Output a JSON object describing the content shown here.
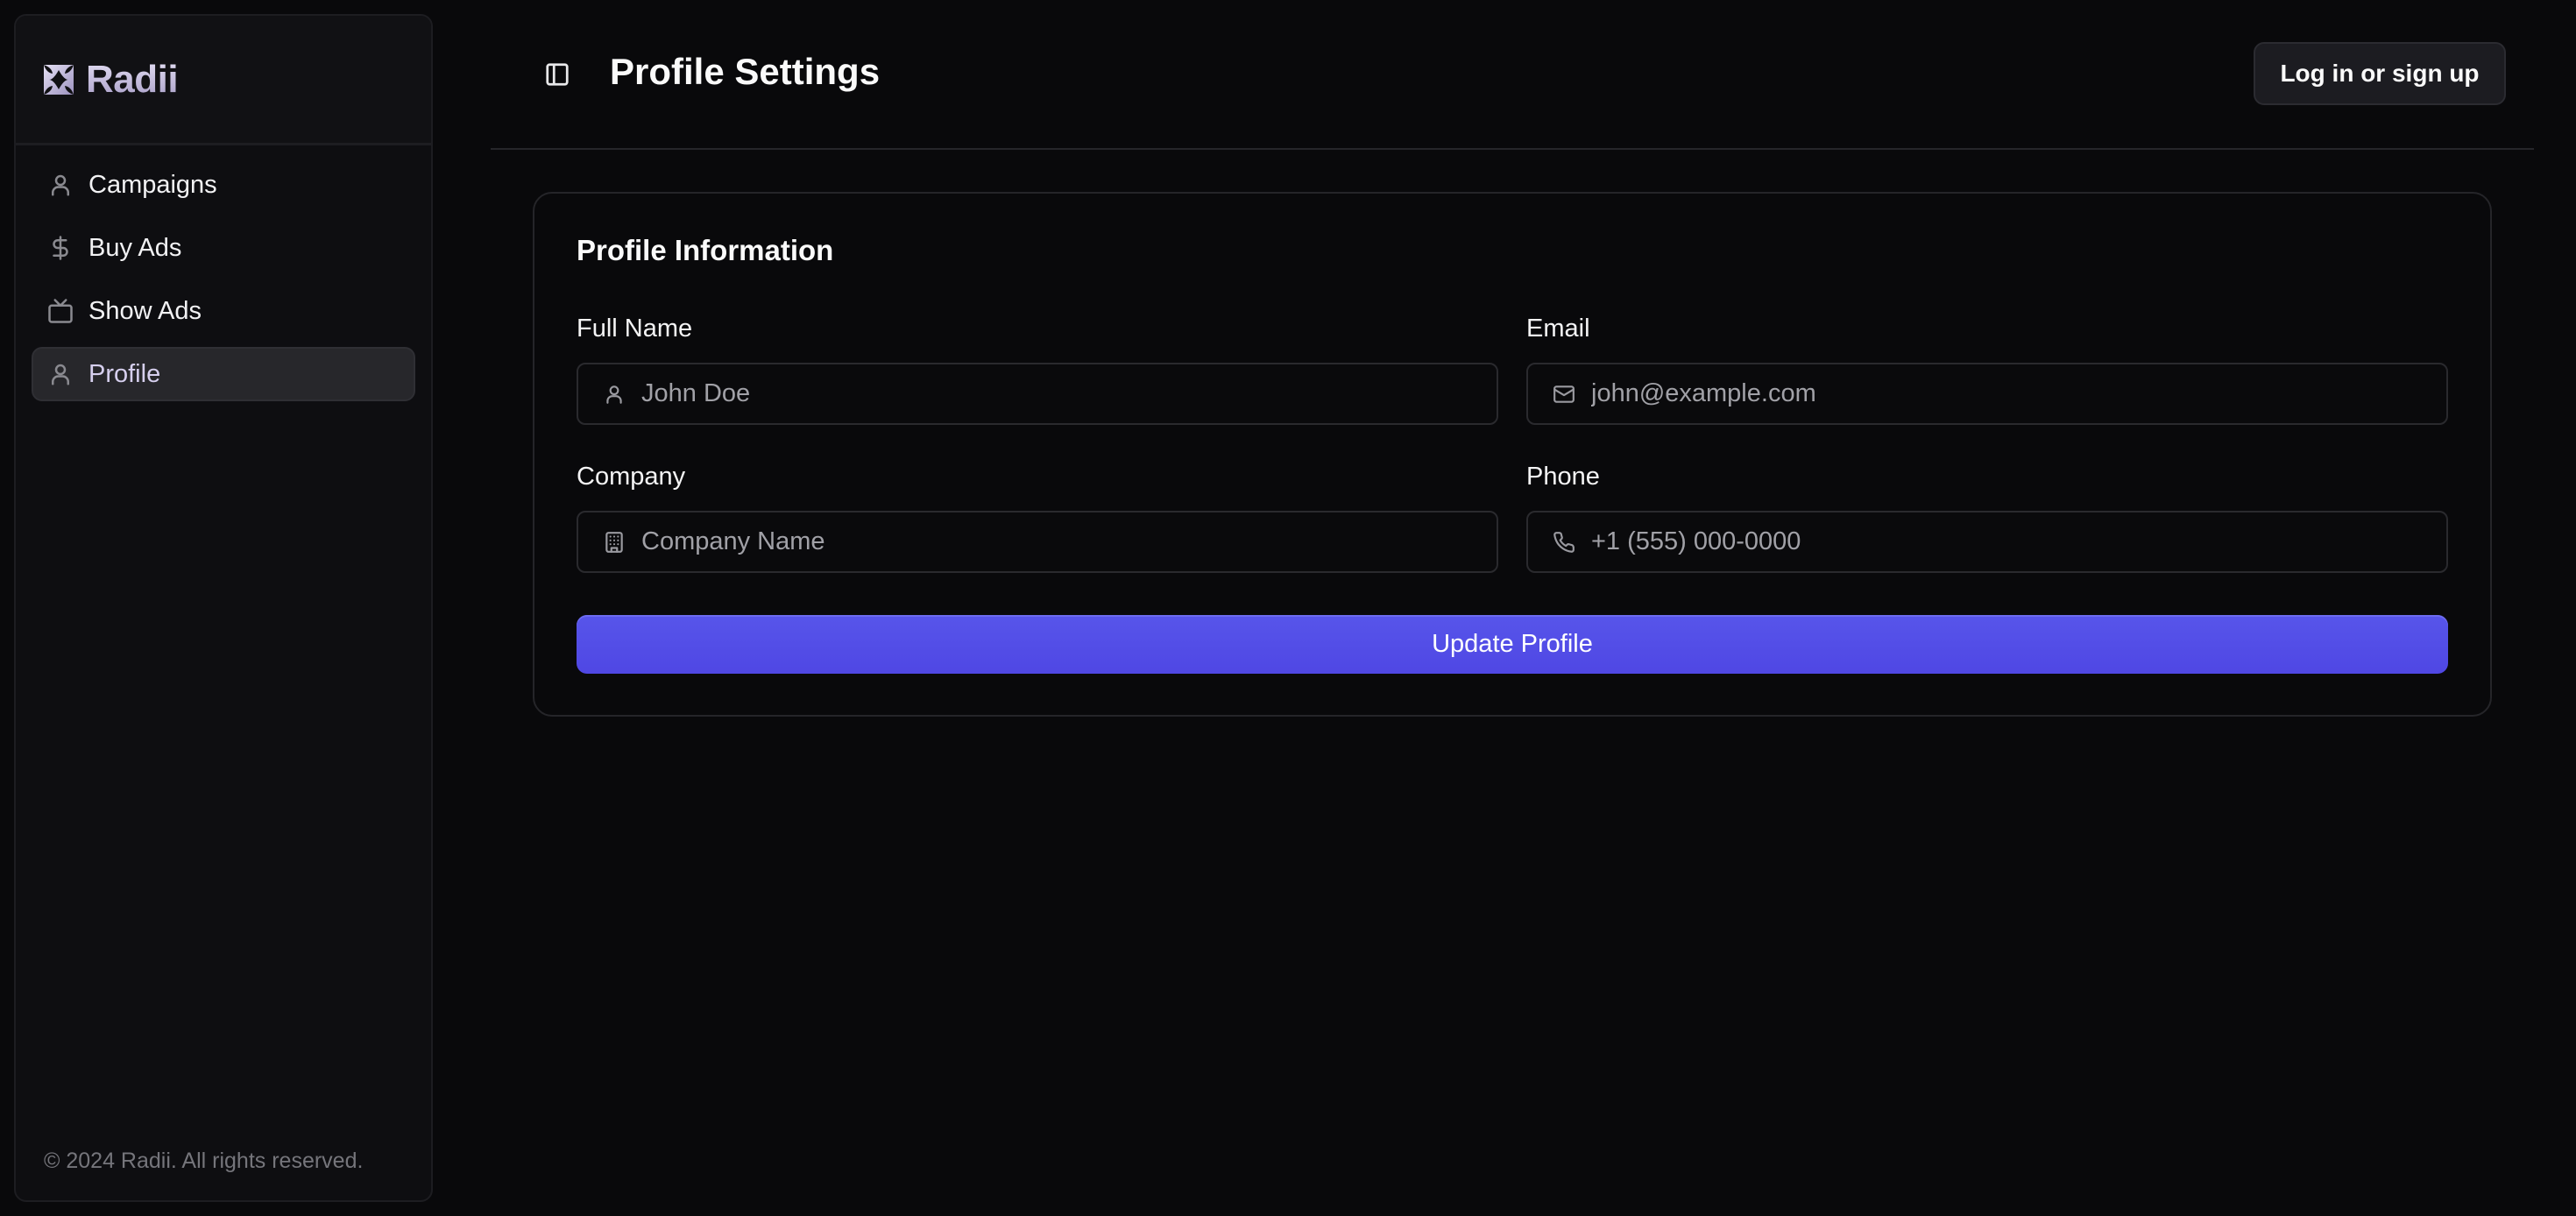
{
  "app": {
    "name": "Radii",
    "footer": "© 2024 Radii. All rights reserved."
  },
  "sidebar": {
    "items": [
      {
        "label": "Campaigns",
        "icon": "user-icon",
        "active": false
      },
      {
        "label": "Buy Ads",
        "icon": "dollar-icon",
        "active": false
      },
      {
        "label": "Show Ads",
        "icon": "tv-icon",
        "active": false
      },
      {
        "label": "Profile",
        "icon": "user-icon",
        "active": true
      }
    ]
  },
  "header": {
    "title": "Profile Settings",
    "toggle_icon": "panel-left-icon",
    "login_label": "Log in or sign up"
  },
  "card": {
    "title": "Profile Information",
    "fields": {
      "full_name": {
        "label": "Full Name",
        "placeholder": "John Doe",
        "value": "",
        "icon": "user-icon"
      },
      "email": {
        "label": "Email",
        "placeholder": "john@example.com",
        "value": "",
        "icon": "mail-icon"
      },
      "company": {
        "label": "Company",
        "placeholder": "Company Name",
        "value": "",
        "icon": "building-icon"
      },
      "phone": {
        "label": "Phone",
        "placeholder": "+1 (555) 000-0000",
        "value": "",
        "icon": "phone-icon"
      }
    },
    "submit_label": "Update Profile"
  },
  "colors": {
    "accent": "#4f46e5",
    "background": "#09090b",
    "sidebar_bg": "#0e0e11",
    "active_item_bg": "#27272b"
  }
}
